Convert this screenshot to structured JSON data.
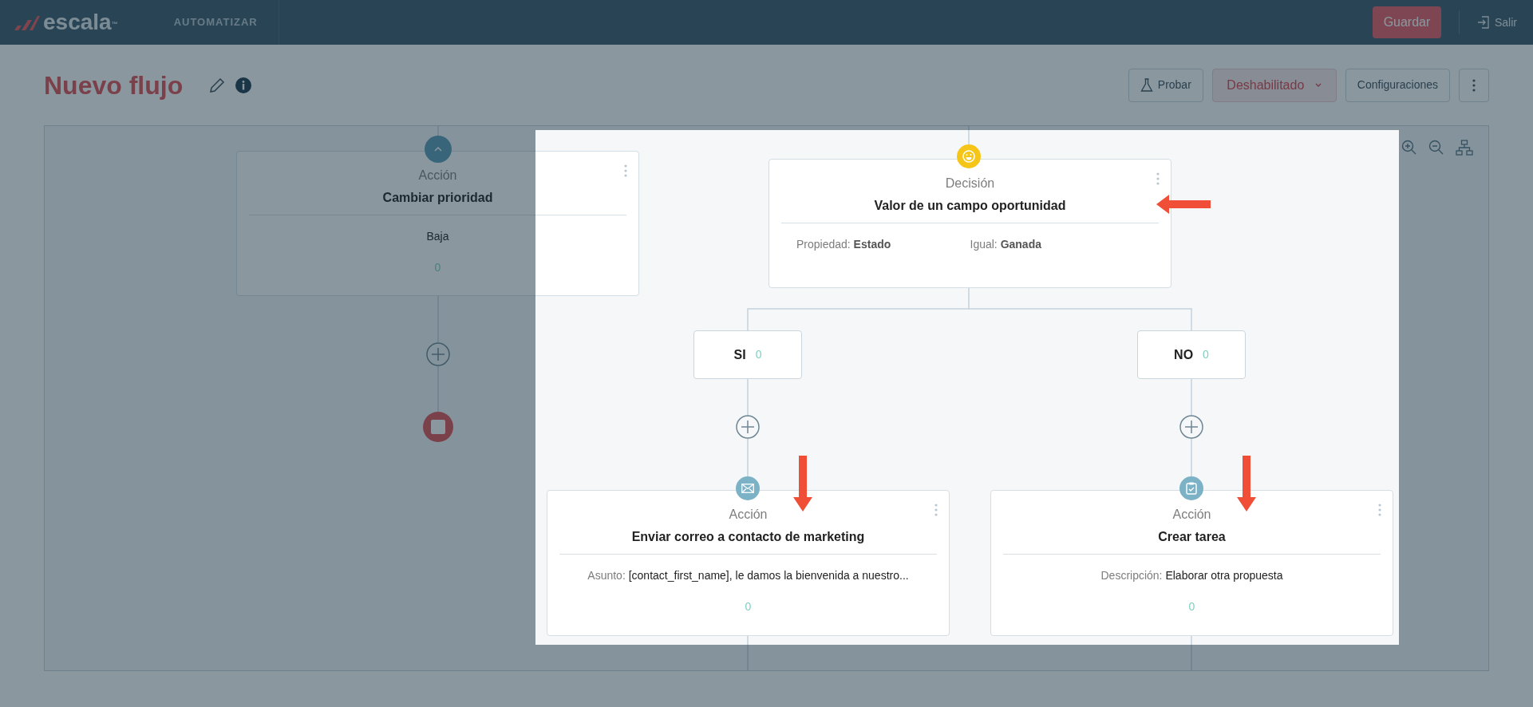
{
  "header": {
    "brand": "escala",
    "trademark": "™",
    "section": "AUTOMATIZAR",
    "save_button": "Guardar",
    "exit_link": "Salir"
  },
  "page": {
    "title": "Nuevo flujo"
  },
  "toolbar": {
    "test_button": "Probar",
    "status_dropdown": "Deshabilitado",
    "settings_button": "Configuraciones"
  },
  "flow": {
    "top_action": {
      "kind": "collapsed_action",
      "type_label": "Acción",
      "title": "Cambiar prioridad",
      "fields": [
        {
          "value": "Baja"
        }
      ],
      "count": "0"
    },
    "decision": {
      "kind": "decision",
      "type_label": "Decisión",
      "title": "Valor de un campo oportunidad",
      "conditions": [
        {
          "label": "Propiedad:",
          "value": "Estado"
        },
        {
          "label": "Igual:",
          "value": "Ganada"
        }
      ]
    },
    "branches": [
      {
        "label": "SI",
        "count": "0",
        "action": {
          "kind": "email_action",
          "type_label": "Acción",
          "title": "Enviar correo a contacto de marketing",
          "fields": [
            {
              "label": "Asunto:",
              "value": "[contact_first_name], le damos la bienvenida a nuestro..."
            }
          ],
          "count": "0"
        }
      },
      {
        "label": "NO",
        "count": "0",
        "action": {
          "kind": "task_action",
          "type_label": "Acción",
          "title": "Crear tarea",
          "fields": [
            {
              "label": "Descripción:",
              "value": "Elaborar otra propuesta"
            }
          ],
          "count": "0"
        }
      }
    ]
  }
}
